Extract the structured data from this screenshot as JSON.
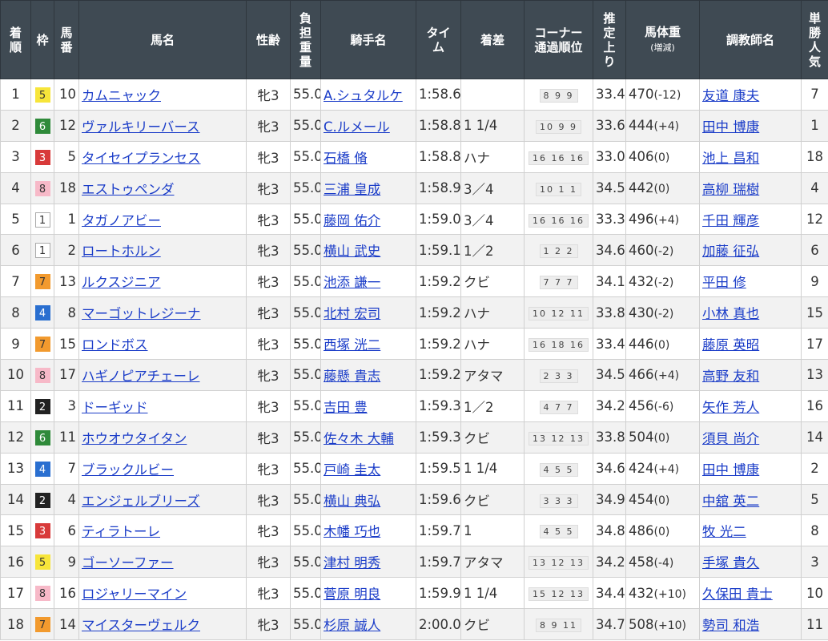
{
  "headers": {
    "rank": "着\n順",
    "waku": "枠",
    "umaban": "馬\n番",
    "name": "馬名",
    "sexage": "性齢",
    "weight": "負\n担\n重\n量",
    "jockey": "騎手名",
    "time": "タイ\nム",
    "margin": "着差",
    "corner": "コーナー\n通過順位",
    "last3f": "推\n定\n上\nり",
    "bodyweight": "馬体重",
    "bodyweight_sub": "(増減)",
    "trainer": "調教師名",
    "popularity": "単\n勝\n人\n気"
  },
  "rows": [
    {
      "rank": "1",
      "waku": "5",
      "umaban": "10",
      "name": "カムニャック",
      "sexage": "牝3",
      "weight": "55.0",
      "jockey": "A.シュタルケ",
      "time": "1:58.6",
      "margin": "",
      "corner": "8 9 9",
      "last3f": "33.4",
      "bw": "470",
      "bwdiff": "(-12)",
      "trainer": "友道 康夫",
      "pop": "7"
    },
    {
      "rank": "2",
      "waku": "6",
      "umaban": "12",
      "name": "ヴァルキリーバース",
      "sexage": "牝3",
      "weight": "55.0",
      "jockey": "C.ルメール",
      "time": "1:58.8",
      "margin": "1 1/4",
      "corner": "10 9 9",
      "last3f": "33.6",
      "bw": "444",
      "bwdiff": "(+4)",
      "trainer": "田中 博康",
      "pop": "1"
    },
    {
      "rank": "3",
      "waku": "3",
      "umaban": "5",
      "name": "タイセイプランセス",
      "sexage": "牝3",
      "weight": "55.0",
      "jockey": "石橋 脩",
      "time": "1:58.8",
      "margin": "ハナ",
      "corner": "16 16 16",
      "last3f": "33.0",
      "bw": "406",
      "bwdiff": "(0)",
      "trainer": "池上 昌和",
      "pop": "18"
    },
    {
      "rank": "4",
      "waku": "8",
      "umaban": "18",
      "name": "エストゥペンダ",
      "sexage": "牝3",
      "weight": "55.0",
      "jockey": "三浦 皇成",
      "time": "1:58.9",
      "margin": "3／4",
      "corner": "10 1 1",
      "last3f": "34.5",
      "bw": "442",
      "bwdiff": "(0)",
      "trainer": "高柳 瑞樹",
      "pop": "4"
    },
    {
      "rank": "5",
      "waku": "1",
      "umaban": "1",
      "name": "タガノアビー",
      "sexage": "牝3",
      "weight": "55.0",
      "jockey": "藤岡 佑介",
      "time": "1:59.0",
      "margin": "3／4",
      "corner": "16 16 16",
      "last3f": "33.3",
      "bw": "496",
      "bwdiff": "(+4)",
      "trainer": "千田 輝彦",
      "pop": "12"
    },
    {
      "rank": "6",
      "waku": "1",
      "umaban": "2",
      "name": "ロートホルン",
      "sexage": "牝3",
      "weight": "55.0",
      "jockey": "横山 武史",
      "time": "1:59.1",
      "margin": "1／2",
      "corner": "1 2 2",
      "last3f": "34.6",
      "bw": "460",
      "bwdiff": "(-2)",
      "trainer": "加藤 征弘",
      "pop": "6"
    },
    {
      "rank": "7",
      "waku": "7",
      "umaban": "13",
      "name": "ルクスジニア",
      "sexage": "牝3",
      "weight": "55.0",
      "jockey": "池添 謙一",
      "time": "1:59.2",
      "margin": "クビ",
      "corner": "7 7 7",
      "last3f": "34.1",
      "bw": "432",
      "bwdiff": "(-2)",
      "trainer": "平田 修",
      "pop": "9"
    },
    {
      "rank": "8",
      "waku": "4",
      "umaban": "8",
      "name": "マーゴットレジーナ",
      "sexage": "牝3",
      "weight": "55.0",
      "jockey": "北村 宏司",
      "time": "1:59.2",
      "margin": "ハナ",
      "corner": "10 12 11",
      "last3f": "33.8",
      "bw": "430",
      "bwdiff": "(-2)",
      "trainer": "小林 真也",
      "pop": "15"
    },
    {
      "rank": "9",
      "waku": "7",
      "umaban": "15",
      "name": "ロンドボス",
      "sexage": "牝3",
      "weight": "55.0",
      "jockey": "西塚 洸二",
      "time": "1:59.2",
      "margin": "ハナ",
      "corner": "16 18 16",
      "last3f": "33.4",
      "bw": "446",
      "bwdiff": "(0)",
      "trainer": "藤原 英昭",
      "pop": "17"
    },
    {
      "rank": "10",
      "waku": "8",
      "umaban": "17",
      "name": "ハギノピアチェーレ",
      "sexage": "牝3",
      "weight": "55.0",
      "jockey": "藤懸 貴志",
      "time": "1:59.2",
      "margin": "アタマ",
      "corner": "2 3 3",
      "last3f": "34.5",
      "bw": "466",
      "bwdiff": "(+4)",
      "trainer": "高野 友和",
      "pop": "13"
    },
    {
      "rank": "11",
      "waku": "2",
      "umaban": "3",
      "name": "ドーギッド",
      "sexage": "牝3",
      "weight": "55.0",
      "jockey": "吉田 豊",
      "time": "1:59.3",
      "margin": "1／2",
      "corner": "4 7 7",
      "last3f": "34.2",
      "bw": "456",
      "bwdiff": "(-6)",
      "trainer": "矢作 芳人",
      "pop": "16"
    },
    {
      "rank": "12",
      "waku": "6",
      "umaban": "11",
      "name": "ホウオウタイタン",
      "sexage": "牝3",
      "weight": "55.0",
      "jockey": "佐々木 大輔",
      "time": "1:59.3",
      "margin": "クビ",
      "corner": "13 12 13",
      "last3f": "33.8",
      "bw": "504",
      "bwdiff": "(0)",
      "trainer": "須貝 尚介",
      "pop": "14"
    },
    {
      "rank": "13",
      "waku": "4",
      "umaban": "7",
      "name": "ブラックルビー",
      "sexage": "牝3",
      "weight": "55.0",
      "jockey": "戸崎 圭太",
      "time": "1:59.5",
      "margin": "1 1/4",
      "corner": "4 5 5",
      "last3f": "34.6",
      "bw": "424",
      "bwdiff": "(+4)",
      "trainer": "田中 博康",
      "pop": "2"
    },
    {
      "rank": "14",
      "waku": "2",
      "umaban": "4",
      "name": "エンジェルブリーズ",
      "sexage": "牝3",
      "weight": "55.0",
      "jockey": "横山 典弘",
      "time": "1:59.6",
      "margin": "クビ",
      "corner": "3 3 3",
      "last3f": "34.9",
      "bw": "454",
      "bwdiff": "(0)",
      "trainer": "中舘 英二",
      "pop": "5"
    },
    {
      "rank": "15",
      "waku": "3",
      "umaban": "6",
      "name": "ティラトーレ",
      "sexage": "牝3",
      "weight": "55.0",
      "jockey": "木幡 巧也",
      "time": "1:59.7",
      "margin": "1",
      "corner": "4 5 5",
      "last3f": "34.8",
      "bw": "486",
      "bwdiff": "(0)",
      "trainer": "牧 光二",
      "pop": "8"
    },
    {
      "rank": "16",
      "waku": "5",
      "umaban": "9",
      "name": "ゴーソーファー",
      "sexage": "牝3",
      "weight": "55.0",
      "jockey": "津村 明秀",
      "time": "1:59.7",
      "margin": "アタマ",
      "corner": "13 12 13",
      "last3f": "34.2",
      "bw": "458",
      "bwdiff": "(-4)",
      "trainer": "手塚 貴久",
      "pop": "3"
    },
    {
      "rank": "17",
      "waku": "8",
      "umaban": "16",
      "name": "ロジャリーマイン",
      "sexage": "牝3",
      "weight": "55.0",
      "jockey": "菅原 明良",
      "time": "1:59.9",
      "margin": "1 1/4",
      "corner": "15 12 13",
      "last3f": "34.4",
      "bw": "432",
      "bwdiff": "(+10)",
      "trainer": "久保田 貴士",
      "pop": "10"
    },
    {
      "rank": "18",
      "waku": "7",
      "umaban": "14",
      "name": "マイスターヴェルク",
      "sexage": "牝3",
      "weight": "55.0",
      "jockey": "杉原 誠人",
      "time": "2:00.0",
      "margin": "クビ",
      "corner": "8 9 11",
      "last3f": "34.7",
      "bw": "508",
      "bwdiff": "(+10)",
      "trainer": "勢司 和浩",
      "pop": "11"
    }
  ]
}
